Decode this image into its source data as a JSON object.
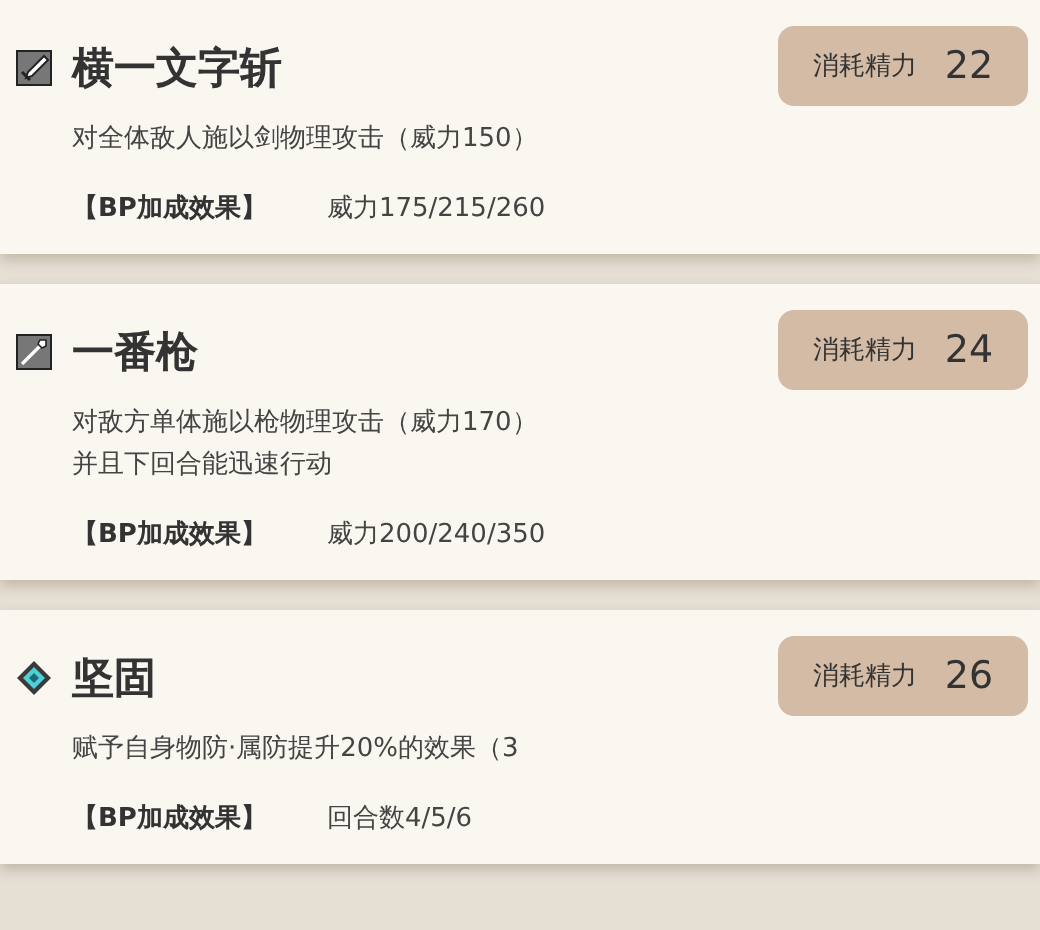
{
  "skills": [
    {
      "kind": "sword",
      "name": "横一文字斩",
      "cost_label": "消耗精力",
      "cost": "22",
      "description": [
        "对全体敌人施以剑物理攻击（威力150）"
      ],
      "bp_label": "【BP加成效果】",
      "bp_value": "威力175/215/260"
    },
    {
      "kind": "spear",
      "name": "一番枪",
      "cost_label": "消耗精力",
      "cost": "24",
      "description": [
        "对敌方单体施以枪物理攻击（威力170）",
        "并且下回合能迅速行动"
      ],
      "bp_label": "【BP加成效果】",
      "bp_value": "威力200/240/350"
    },
    {
      "kind": "shield",
      "name": "坚固",
      "cost_label": "消耗精力",
      "cost": "26",
      "description": [
        "赋予自身物防·属防提升20%的效果（3"
      ],
      "bp_label": "【BP加成效果】",
      "bp_value": "回合数4/5/6"
    }
  ]
}
